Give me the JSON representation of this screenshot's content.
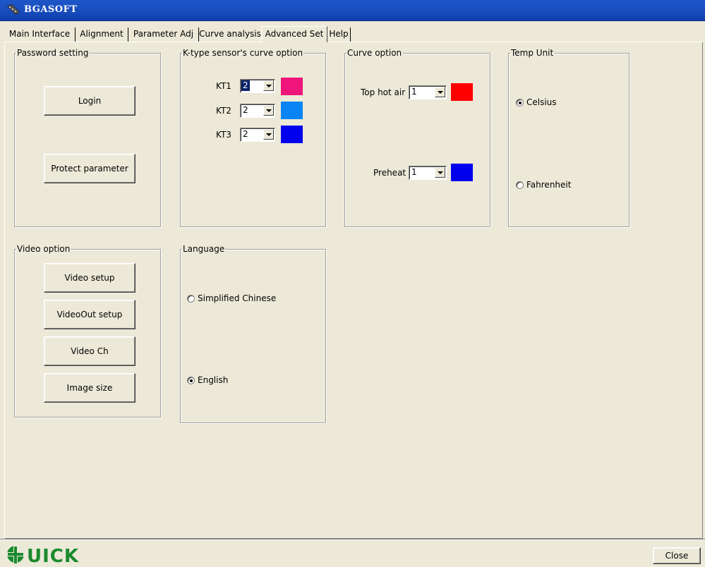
{
  "window": {
    "title": "BGASOFT",
    "icon": "app-icon"
  },
  "tabs": [
    {
      "label": "Main Interface"
    },
    {
      "label": "Alignment"
    },
    {
      "label": "Parameter Adj"
    },
    {
      "label": "Curve analysis"
    },
    {
      "label": "Advanced Set",
      "active": true
    },
    {
      "label": "Help"
    }
  ],
  "password": {
    "legend": "Password setting",
    "login_label": "Login",
    "protect_label": "Protect parameter"
  },
  "ktype": {
    "legend": "K-type sensor's curve option",
    "rows": [
      {
        "label": "KT1",
        "value": "2",
        "color": "#f0157a"
      },
      {
        "label": "KT2",
        "value": "2",
        "color": "#0a84f4"
      },
      {
        "label": "KT3",
        "value": "2",
        "color": "#0000ee"
      }
    ]
  },
  "curve": {
    "legend": "Curve option",
    "top_label": "Top hot air",
    "top_value": "1",
    "top_color": "#ff0000",
    "preheat_label": "Preheat",
    "preheat_value": "1",
    "preheat_color": "#0000ee"
  },
  "temp": {
    "legend": "Temp Unit",
    "celsius_label": "Celsius",
    "fahrenheit_label": "Fahrenheit",
    "selected": "Celsius"
  },
  "video": {
    "legend": "Video option",
    "setup_label": "Video setup",
    "out_label": "VideoOut setup",
    "ch_label": "Video Ch",
    "size_label": "Image size"
  },
  "language": {
    "legend": "Language",
    "chinese_label": "Simplified Chinese",
    "english_label": "English",
    "selected": "English"
  },
  "footer": {
    "logo_text": "UICK",
    "close_label": "Close"
  }
}
